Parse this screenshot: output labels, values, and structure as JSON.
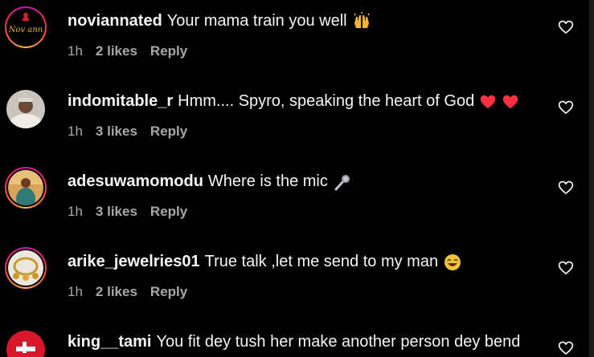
{
  "comments": [
    {
      "username": "noviannated",
      "text": "Your mama train you well",
      "time": "1h",
      "likes": "2 likes",
      "reply": "Reply",
      "avatar_text": "Nov ann",
      "emoji_icon": "raised-hands-icon"
    },
    {
      "username": "indomitable_r",
      "text": "Hmm.... Spyro, speaking the heart of God",
      "time": "1h",
      "likes": "3 likes",
      "reply": "Reply",
      "emoji_icon": "red-heart-icon"
    },
    {
      "username": "adesuwamomodu",
      "text": "Where is the mic",
      "time": "1h",
      "likes": "3 likes",
      "reply": "Reply",
      "emoji_icon": "microphone-icon"
    },
    {
      "username": "arike_jewelries01",
      "text": "True talk ,let me send to my man",
      "time": "1h",
      "likes": "2 likes",
      "reply": "Reply",
      "emoji_icon": "laughing-face-icon"
    },
    {
      "username": "king__tami",
      "text": "You fit dey tush her make another person dey bend"
    }
  ],
  "colors": {
    "background": "#000000",
    "primary_text": "#f5f5f5",
    "secondary_text": "#a8a8a8",
    "heart_red": "#ff3040",
    "story_ring": "#c913b9"
  }
}
